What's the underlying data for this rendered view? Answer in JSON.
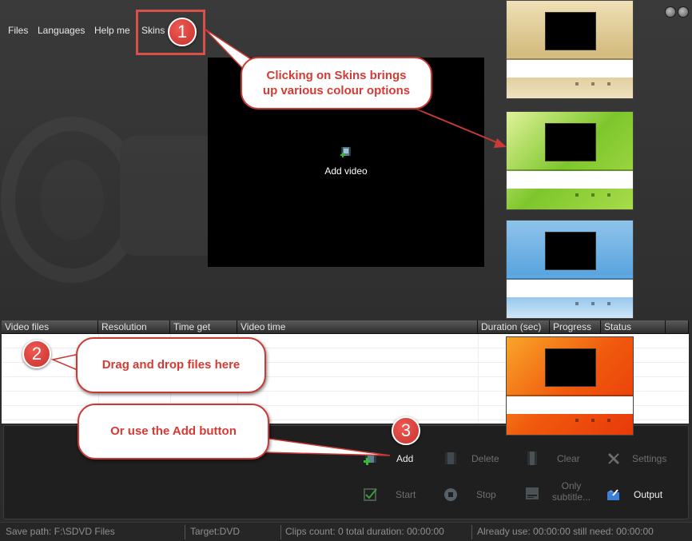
{
  "menu": {
    "files": "Files",
    "languages": "Languages",
    "help": "Help me",
    "skins": "Skins"
  },
  "preview": {
    "icon": "film-add-icon",
    "label": "Add video"
  },
  "skins": [
    {
      "name": "gold",
      "color": "#d4bb7e"
    },
    {
      "name": "green",
      "color": "#7ec62c"
    },
    {
      "name": "blue",
      "color": "#5aa5e0"
    },
    {
      "name": "orange",
      "color": "#f05a0d"
    }
  ],
  "file_list": {
    "columns": [
      "Video files",
      "Resolution",
      "Time get",
      "Video time",
      "Duration (sec)",
      "Progress",
      "Status"
    ],
    "rows": []
  },
  "toolbar": {
    "add": "Add",
    "delete": "Delete",
    "clear": "Clear",
    "settings": "Settings",
    "start": "Start",
    "stop": "Stop",
    "only_subtitle_line1": "Only",
    "only_subtitle_line2": "subtitle...",
    "output": "Output"
  },
  "status_bar": {
    "save_path": "Save path:  F:\\SDVD Files",
    "target": "Target:DVD",
    "clips": "Clips count: 0 total duration: 00:00:00",
    "usage": "Already use: 00:00:00 still need: 00:00:00"
  },
  "annotations": {
    "badge1": "1",
    "badge2": "2",
    "badge3": "3",
    "callout_skins_line1": "Clicking on Skins brings",
    "callout_skins_line2": "up various colour options",
    "callout_drag": "Drag and drop files here",
    "callout_add": "Or use the Add button",
    "accent_color": "#d9504b"
  }
}
